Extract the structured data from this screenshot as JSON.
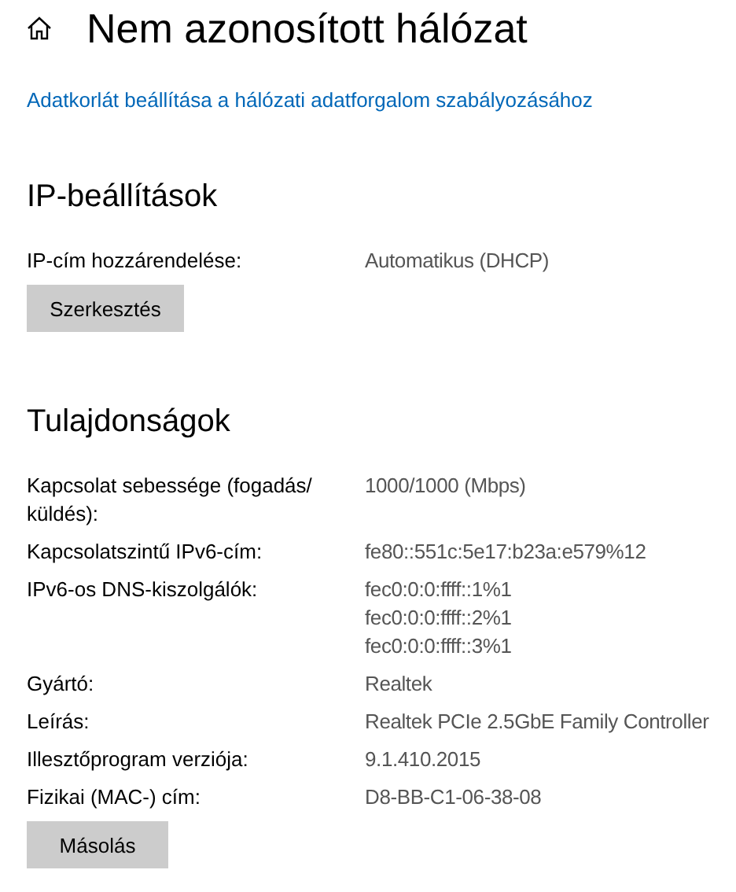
{
  "header": {
    "title": "Nem azonosított hálózat"
  },
  "data_limit_link": "Adatkorlát beállítása a hálózati adatforgalom szabályozásához",
  "ip_settings": {
    "heading": "IP-beállítások",
    "rows": [
      {
        "label": "IP-cím hozzárendelése:",
        "values": [
          "Automatikus (DHCP)"
        ]
      }
    ],
    "button": "Szerkesztés"
  },
  "properties": {
    "heading": "Tulajdonságok",
    "rows": [
      {
        "label": "Kapcsolat sebessége (fogadás/ küldés):",
        "values": [
          "1000/1000 (Mbps)"
        ]
      },
      {
        "label": "Kapcsolatszintű IPv6-cím:",
        "values": [
          "fe80::551c:5e17:b23a:e579%12"
        ]
      },
      {
        "label": "IPv6-os DNS-kiszolgálók:",
        "values": [
          "fec0:0:0:ffff::1%1",
          "fec0:0:0:ffff::2%1",
          "fec0:0:0:ffff::3%1"
        ]
      },
      {
        "label": "Gyártó:",
        "values": [
          "Realtek"
        ]
      },
      {
        "label": "Leírás:",
        "values": [
          "Realtek PCIe 2.5GbE Family Controller"
        ]
      },
      {
        "label": "Illesztőprogram verziója:",
        "values": [
          "9.1.410.2015"
        ]
      },
      {
        "label": "Fizikai (MAC-) cím:",
        "values": [
          "D8-BB-C1-06-38-08"
        ]
      }
    ],
    "button": "Másolás"
  }
}
